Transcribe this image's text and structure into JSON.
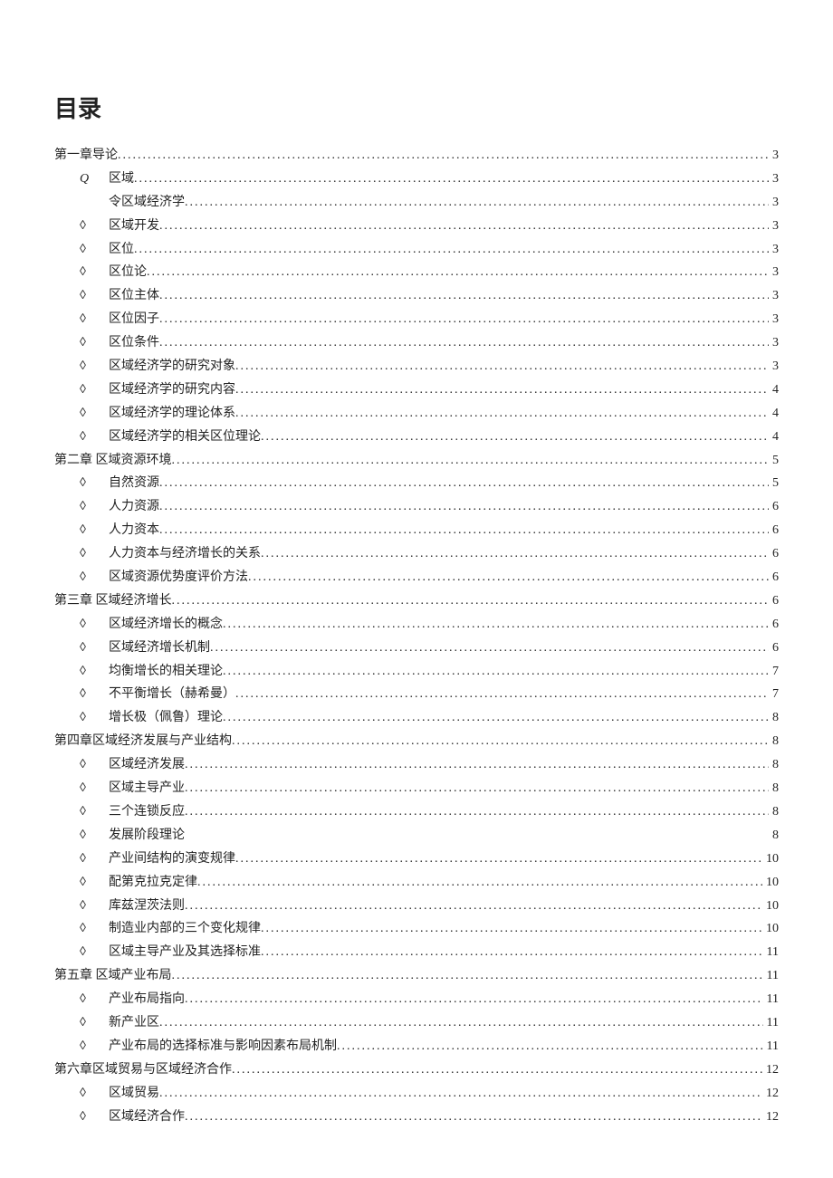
{
  "title": "目录",
  "entries": [
    {
      "indent": 0,
      "marker": "",
      "label": "第一章导论",
      "page": "3",
      "dotted": true
    },
    {
      "indent": 1,
      "marker": "Q",
      "markerItalic": true,
      "label": "区域",
      "page": "3",
      "dotted": true
    },
    {
      "indent": 1,
      "marker": "",
      "label": "令区域经济学",
      "page": "3",
      "dotted": true
    },
    {
      "indent": 1,
      "marker": "◊",
      "label": "区域开发",
      "page": "3",
      "dotted": true
    },
    {
      "indent": 1,
      "marker": "◊",
      "label": "区位",
      "page": "3",
      "dotted": true
    },
    {
      "indent": 1,
      "marker": "◊",
      "label": "区位论",
      "page": "3",
      "dotted": true
    },
    {
      "indent": 1,
      "marker": "◊",
      "label": "区位主体",
      "page": "3",
      "dotted": true
    },
    {
      "indent": 1,
      "marker": "◊",
      "label": "区位因子",
      "page": "3",
      "dotted": true
    },
    {
      "indent": 1,
      "marker": "◊",
      "label": "区位条件",
      "page": "3",
      "dotted": true
    },
    {
      "indent": 1,
      "marker": "◊",
      "label": "区域经济学的研究对象",
      "page": "3",
      "dotted": true
    },
    {
      "indent": 1,
      "marker": "◊",
      "label": "区域经济学的研究内容",
      "page": "4",
      "dotted": true
    },
    {
      "indent": 1,
      "marker": "◊",
      "label": "区域经济学的理论体系",
      "page": "4",
      "dotted": true
    },
    {
      "indent": 1,
      "marker": "◊",
      "label": "区域经济学的相关区位理论",
      "page": "4",
      "dotted": true
    },
    {
      "indent": 0,
      "marker": "",
      "label": "第二章   区域资源环境",
      "page": "5",
      "dotted": true
    },
    {
      "indent": 1,
      "marker": "◊",
      "label": "自然资源",
      "page": "5",
      "dotted": true
    },
    {
      "indent": 1,
      "marker": "◊",
      "label": "人力资源",
      "page": "6",
      "dotted": true
    },
    {
      "indent": 1,
      "marker": "◊",
      "label": "人力资本",
      "page": "6",
      "dotted": true
    },
    {
      "indent": 1,
      "marker": "◊",
      "label": "人力资本与经济增长的关系",
      "page": "6",
      "dotted": true
    },
    {
      "indent": 1,
      "marker": "◊",
      "label": "区域资源优势度评价方法",
      "page": "6",
      "dotted": true
    },
    {
      "indent": 0,
      "marker": "",
      "label": "第三章   区域经济增长",
      "page": "6",
      "dotted": true
    },
    {
      "indent": 1,
      "marker": "◊",
      "label": "区域经济增长的概念",
      "page": "6",
      "dotted": true
    },
    {
      "indent": 1,
      "marker": "◊",
      "label": "区域经济增长机制",
      "page": "6",
      "dotted": true
    },
    {
      "indent": 1,
      "marker": "◊",
      "label": "均衡增长的相关理论",
      "page": "7",
      "dotted": true
    },
    {
      "indent": 1,
      "marker": "◊",
      "label": "不平衡增长（赫希曼）",
      "page": "7",
      "dotted": true
    },
    {
      "indent": 1,
      "marker": "◊",
      "label": "增长极（佩鲁）理论",
      "page": "8",
      "dotted": true
    },
    {
      "indent": 0,
      "marker": "",
      "label": "第四章区域经济发展与产业结构",
      "page": "8",
      "dotted": true
    },
    {
      "indent": 1,
      "marker": "◊",
      "label": "区域经济发展",
      "page": "8",
      "dotted": true
    },
    {
      "indent": 1,
      "marker": "◊",
      "label": "区域主导产业",
      "page": "8",
      "dotted": true
    },
    {
      "indent": 1,
      "marker": "◊",
      "label": "三个连锁反应",
      "page": "8",
      "dotted": true
    },
    {
      "indent": 1,
      "marker": "◊",
      "label": "发展阶段理论",
      "page": "8",
      "dotted": false
    },
    {
      "indent": 1,
      "marker": "◊",
      "label": "产业间结构的演变规律",
      "page": "10",
      "dotted": true
    },
    {
      "indent": 1,
      "marker": "◊",
      "label": "配第克拉克定律",
      "page": "10",
      "dotted": true
    },
    {
      "indent": 1,
      "marker": "◊",
      "label": "库兹涅茨法则",
      "page": "10",
      "dotted": true
    },
    {
      "indent": 1,
      "marker": "◊",
      "label": "制造业内部的三个变化规律",
      "page": "10",
      "dotted": true
    },
    {
      "indent": 1,
      "marker": "◊",
      "label": "区域主导产业及其选择标准",
      "page": "11",
      "dotted": true
    },
    {
      "indent": 0,
      "marker": "",
      "label": "第五章   区域产业布局",
      "page": "11",
      "dotted": true
    },
    {
      "indent": 1,
      "marker": "◊",
      "label": "产业布局指向",
      "page": "11",
      "dotted": true
    },
    {
      "indent": 1,
      "marker": "◊",
      "label": "新产业区",
      "page": "11",
      "dotted": true
    },
    {
      "indent": 1,
      "marker": "◊",
      "label": "产业布局的选择标准与影响因素布局机制",
      "page": "11",
      "dotted": true
    },
    {
      "indent": 0,
      "marker": "",
      "label": "第六章区域贸易与区域经济合作",
      "page": "12",
      "dotted": true
    },
    {
      "indent": 1,
      "marker": "◊",
      "label": "区域贸易",
      "page": "12",
      "dotted": true
    },
    {
      "indent": 1,
      "marker": "◊",
      "label": "区域经济合作",
      "page": "12",
      "dotted": true
    }
  ]
}
